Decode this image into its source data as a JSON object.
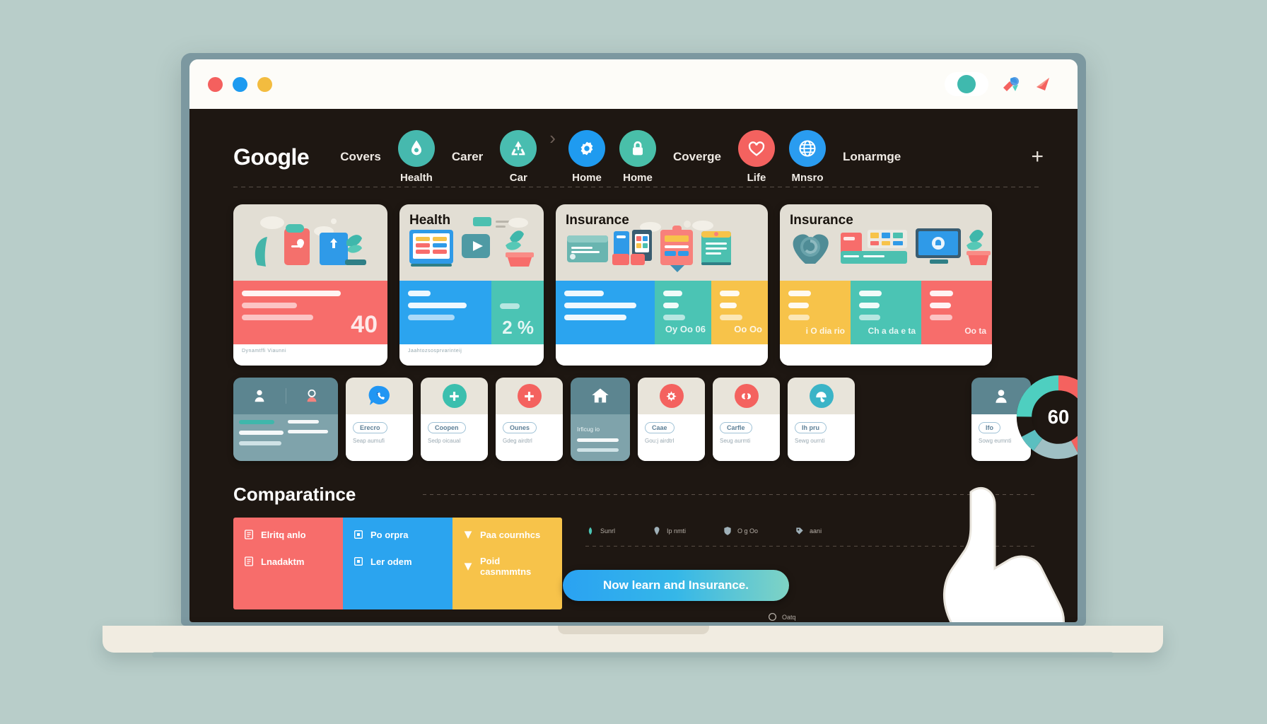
{
  "browser": {
    "dots": [
      "red",
      "blue",
      "yellow"
    ],
    "right_icons": [
      "profile-avatar-icon",
      "extension-puzzle-icon",
      "send-arrow-icon"
    ]
  },
  "nav": {
    "brand": "Google",
    "items": [
      {
        "type": "word",
        "label": "Covers"
      },
      {
        "type": "icon",
        "label": "Health",
        "icon": "health-drop-icon",
        "color": "#46b9ae"
      },
      {
        "type": "word",
        "label": "Carer"
      },
      {
        "type": "icon",
        "label": "Car",
        "icon": "recycle-car-icon",
        "color": "#49bdb0"
      },
      {
        "type": "chev",
        "label": "›"
      },
      {
        "type": "icon",
        "label": "Home",
        "icon": "gear-icon",
        "color": "#1f9bf0"
      },
      {
        "type": "icon",
        "label": "Home",
        "icon": "lock-icon",
        "color": "#49bfa9"
      },
      {
        "type": "word",
        "label": "Coverge"
      },
      {
        "type": "icon",
        "label": "Life",
        "icon": "heart-icon",
        "color": "#f4625f"
      },
      {
        "type": "icon",
        "label": "Mnsro",
        "icon": "globe-icon",
        "color": "#2a9cf0"
      },
      {
        "type": "word",
        "label": "Lonarmge"
      }
    ],
    "add_label": "+"
  },
  "cards": [
    {
      "title": "",
      "footer": "Dynamtffi Viaunni",
      "number": "40",
      "segments": [
        {
          "color": "#f76d6b",
          "lines": [
            100,
            55,
            70
          ],
          "value": ""
        }
      ]
    },
    {
      "title": "Health",
      "footer": "Jaahtozsosprvarinteij",
      "number": "2 %",
      "segments": [
        {
          "color": "#2ba4ef",
          "lines": [
            45,
            85,
            70
          ],
          "value": ""
        },
        {
          "color": "#4bc4b4",
          "lines": [
            0,
            0,
            0
          ],
          "value": "2 %"
        }
      ]
    },
    {
      "title": "Insurance",
      "footer": "",
      "number": "",
      "segments": [
        {
          "color": "#2ba4ef",
          "lines": [
            60,
            95,
            80
          ],
          "value": ""
        },
        {
          "color": "#4bc4b4",
          "lines": [
            55,
            40,
            48
          ],
          "value": "Oy Oo 06"
        },
        {
          "color": "#f7c34a",
          "lines": [
            55,
            45,
            50
          ],
          "value": "Oo Oo"
        }
      ]
    },
    {
      "title": "Insurance",
      "footer": "",
      "number": "",
      "segments": [
        {
          "color": "#f7c34a",
          "lines": [
            50,
            45,
            42
          ],
          "value": "i O dia rio"
        },
        {
          "color": "#4bc4b4",
          "lines": [
            50,
            44,
            46
          ],
          "value": "Ch a da e ta"
        },
        {
          "color": "#f76d6b",
          "lines": [
            52,
            46,
            44
          ],
          "value": "Oo ta"
        }
      ]
    }
  ],
  "tiles": [
    {
      "kind": "dark-pair",
      "icons": [
        "person-icon",
        "agent-headset-icon"
      ],
      "lines": 4
    },
    {
      "kind": "light",
      "icon": "chat-phone-icon",
      "icon_color": "#2196f3",
      "button": "Erecro",
      "sub": "Seap aumufi"
    },
    {
      "kind": "light",
      "icon": "plus-icon",
      "icon_color": "#3bbfae",
      "button": "Coopen",
      "sub": "Sedp oicaual"
    },
    {
      "kind": "light",
      "icon": "plus-icon",
      "icon_color": "#f4625f",
      "button": "Ounes",
      "sub": "Gdeg airdtrl"
    },
    {
      "kind": "dark",
      "icon": "home-icon",
      "icon_color": "#ffffff",
      "button": "Irficug io",
      "sub": ""
    },
    {
      "kind": "light",
      "icon": "health-cross-icon",
      "icon_color": "#f4625f",
      "button": "Caae",
      "sub": "Gou:j airdtrl"
    },
    {
      "kind": "light",
      "icon": "link-icon",
      "icon_color": "#f4625f",
      "button": "Carfle",
      "sub": "Seug aurmti"
    },
    {
      "kind": "light",
      "icon": "umbrella-icon",
      "icon_color": "#3bb4c7",
      "button": "Ih pru",
      "sub": "Sewg ournti"
    },
    {
      "kind": "dark",
      "icon": "user-support-icon",
      "icon_color": "#ffffff",
      "button": "lfo",
      "sub": "Sowg eumnti"
    }
  ],
  "donut": {
    "center_label": "60",
    "segments": [
      {
        "name": "teal",
        "color": "#4ecfc0",
        "value": 25
      },
      {
        "name": "coral",
        "color": "#f4625f",
        "value": 42
      },
      {
        "name": "slate",
        "color": "#9fc0c4",
        "value": 18
      },
      {
        "name": "aqua",
        "color": "#5bbfc0",
        "value": 7
      },
      {
        "name": "empty",
        "color": "#1e1712",
        "value": 8
      }
    ]
  },
  "comparison": {
    "heading": "Comparatince",
    "columns": [
      {
        "color": "#f76d6b",
        "items": [
          {
            "icon": "document-icon",
            "label": "Elritq anlo"
          },
          {
            "icon": "document-icon",
            "label": "Lnadaktm"
          }
        ]
      },
      {
        "color": "#2ba4ef",
        "items": [
          {
            "icon": "square-dot-icon",
            "label": "Po orpra"
          },
          {
            "icon": "square-dot-icon",
            "label": "Ler odem"
          }
        ]
      },
      {
        "color": "#f7c34a",
        "items": [
          {
            "icon": "check-icon",
            "label": "Paa cournhcs"
          },
          {
            "icon": "check-icon",
            "label": "Poid casnmmtns"
          }
        ]
      }
    ]
  },
  "ministats": [
    {
      "icon": "leaf-icon",
      "color": "#4bc4b4",
      "label": "Sunrl"
    },
    {
      "icon": "marker-icon",
      "color": "#9fb0b8",
      "label": "Ip nmti"
    },
    {
      "icon": "shield-icon",
      "color": "#9fb0b8",
      "label": "O g Oo"
    },
    {
      "icon": "tag-icon",
      "color": "#9fb0b8",
      "label": "aani"
    }
  ],
  "cta": {
    "label": "Now learn and Insurance."
  },
  "bottom_legend": {
    "icon": "circle-icon",
    "label": "Oatq"
  }
}
